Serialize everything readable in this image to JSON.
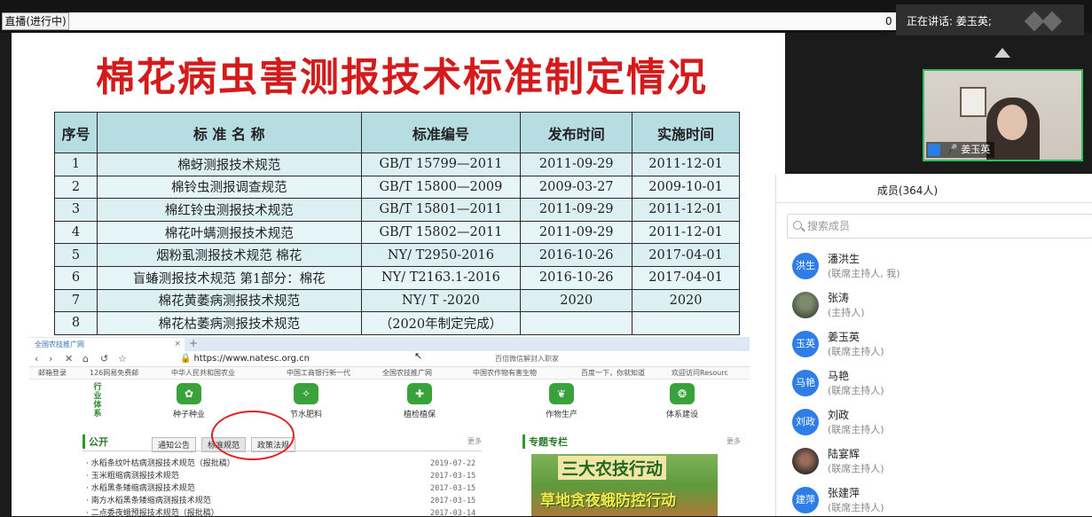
{
  "topbar": {
    "live_label": "直播(进行中)",
    "zoom_value": "0",
    "speaker_text": "正在讲话: 姜玉英;"
  },
  "slide": {
    "title": "棉花病虫害测报技术标准制定情况",
    "table": {
      "headers": [
        "序号",
        "标 准 名 称",
        "标准编号",
        "发布时间",
        "实施时间"
      ],
      "rows": [
        [
          "1",
          "棉蚜测报技术规范",
          "GB/T  15799—2011",
          "2011-09-29",
          "2011-12-01"
        ],
        [
          "2",
          "棉铃虫测报调查规范",
          "GB/T  15800—2009",
          "2009-03-27",
          "2009-10-01"
        ],
        [
          "3",
          "棉红铃虫测报技术规范",
          "GB/T  15801—2011",
          "2011-09-29",
          "2011-12-01"
        ],
        [
          "4",
          "棉花叶螨测报技术规范",
          "GB/T  15802—2011",
          "2011-09-29",
          "2011-12-01"
        ],
        [
          "5",
          "烟粉虱测报技术规范  棉花",
          "NY/ T2950-2016",
          "2016-10-26",
          "2017-04-01"
        ],
        [
          "6",
          "盲蝽测报技术规范 第1部分：棉花",
          "NY/ T2163.1-2016",
          "2016-10-26",
          "2017-04-01"
        ],
        [
          "7",
          "棉花黄萎病测报技术规范",
          "NY/ T     -2020",
          "2020",
          "2020"
        ],
        [
          "8",
          "棉花枯萎病测报技术规范",
          "（2020年制定完成）",
          "",
          ""
        ]
      ]
    }
  },
  "browser": {
    "tab_title": "全国农技推广网",
    "url": "https://www.natesc.org.cn",
    "address_right": "百倍微信解封入职家",
    "bookmarks": [
      "邮箱登录",
      "126网易免费邮",
      "中华人民共和国农业",
      "中国工商银行新一代",
      "全国农技推广网",
      "中国农作物有害生物",
      "百度一下，你就知道",
      "欢迎访问Resourc"
    ],
    "site_vertical": "行业体系",
    "categories": [
      "种子种业",
      "节水肥料",
      "植检植保",
      "作物生产",
      "体系建设"
    ],
    "public_title": "公开",
    "public_tabs": [
      "通知公告",
      "标准规范",
      "政策法规"
    ],
    "more_label": "更多",
    "news": [
      {
        "title": "· 水稻条纹叶枯病测报技术规范（报批稿）",
        "date": "2019-07-22"
      },
      {
        "title": "· 玉米粗缩病测报技术规范",
        "date": "2017-03-15"
      },
      {
        "title": "· 水稻黑条矮缩病测报技术规范",
        "date": "2017-03-15"
      },
      {
        "title": "· 南方水稻黑条矮缩病测报技术规范",
        "date": "2017-03-15"
      },
      {
        "title": "· 二点委夜蛾预报技术规范（报批稿）",
        "date": "2017-03-14"
      }
    ],
    "special_title": "专题专栏",
    "banner_line1": "三大农技行动",
    "banner_line2": "草地贪夜蛾防控行动"
  },
  "video": {
    "name": "姜玉英"
  },
  "members_panel": {
    "title": "成员(364人)",
    "search_placeholder": "搜索成员",
    "members": [
      {
        "avatar": "洪生",
        "name": "潘洪生",
        "role": "(联席主持人, 我)"
      },
      {
        "avatar": "",
        "name": "张涛",
        "role": "(主持人)"
      },
      {
        "avatar": "玉英",
        "name": "姜玉英",
        "role": "(联席主持人)"
      },
      {
        "avatar": "马艳",
        "name": "马艳",
        "role": "(联席主持人)"
      },
      {
        "avatar": "刘政",
        "name": "刘政",
        "role": "(联席主持人)"
      },
      {
        "avatar": "",
        "name": "陆宴辉",
        "role": "(联席主持人)"
      },
      {
        "avatar": "建萍",
        "name": "张建萍",
        "role": "(联席主持人)"
      }
    ]
  },
  "colors": {
    "title_red": "#d41a1a",
    "table_header": "#b6dde2",
    "table_body": "#dcf0f3",
    "active_speaker_border": "#2cbf5a",
    "avatar_blue": "#2f7de6"
  }
}
